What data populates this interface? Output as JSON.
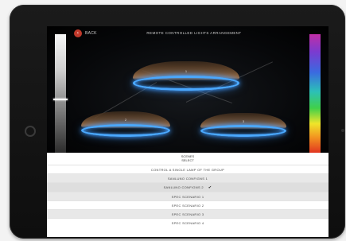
{
  "app": {
    "title": "REMOTE CONTROLLED LIGHTS ARRANGEMENT",
    "back_label": "BACK",
    "back_icon": "back-arrow-icon"
  },
  "scene": {
    "lamps": [
      {
        "name": "lamp-top",
        "label": "1"
      },
      {
        "name": "lamp-left",
        "label": "2"
      },
      {
        "name": "lamp-right",
        "label": "3"
      }
    ],
    "brightness_level": 0.45,
    "accent_ring_color": "#4aa8ff"
  },
  "menu": {
    "header_line1": "SCENES",
    "header_line2": "SELECT",
    "items": [
      {
        "label": "CONTROL A SINGLE LAMP OF THE GROUP",
        "style": "plain"
      },
      {
        "label": "SANLUNO CONFIGNS 1",
        "style": "alt"
      },
      {
        "label": "SANLUNO CONFIGNS 2",
        "style": "selected",
        "check": "✔"
      },
      {
        "label": "SPEC SCENARIO 1",
        "style": "alt"
      },
      {
        "label": "SPEC SCENARIO 2",
        "style": "plain"
      },
      {
        "label": "SPEC SCENARIO 3",
        "style": "alt"
      },
      {
        "label": "SPEC SCENARIO 4",
        "style": "plain"
      }
    ]
  }
}
